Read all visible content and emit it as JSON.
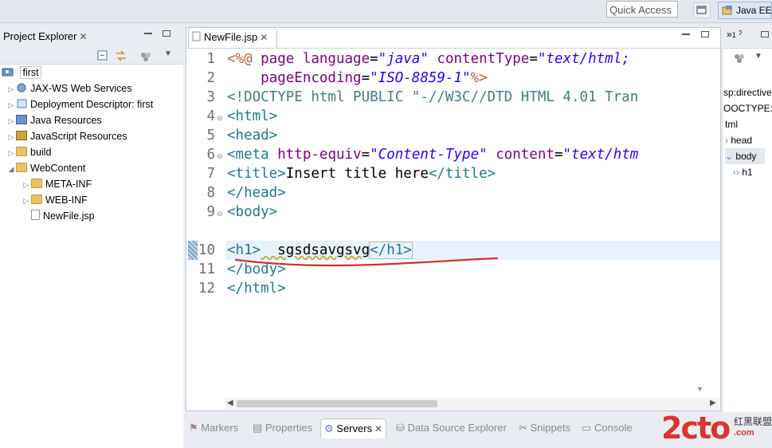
{
  "toolbar": {
    "quick_access": "Quick Access",
    "perspective": "Java EE"
  },
  "project_explorer": {
    "tab_label": "Project Explorer",
    "root": "first",
    "items": [
      {
        "label": "JAX-WS Web Services",
        "icon": "webservice-icon"
      },
      {
        "label": "Deployment Descriptor: first",
        "icon": "deployment-descriptor-icon"
      },
      {
        "label": "Java Resources",
        "icon": "java-resources-icon"
      },
      {
        "label": "JavaScript Resources",
        "icon": "javascript-resources-icon"
      },
      {
        "label": "build",
        "icon": "folder-icon"
      },
      {
        "label": "WebContent",
        "icon": "folder-icon"
      },
      {
        "label": "META-INF",
        "icon": "folder-icon"
      },
      {
        "label": "WEB-INF",
        "icon": "folder-icon"
      },
      {
        "label": "NewFile.jsp",
        "icon": "jsp-file-icon"
      }
    ]
  },
  "editor": {
    "tab_label": "NewFile.jsp",
    "line_numbers": [
      "1",
      "2",
      "3",
      "4",
      "5",
      "6",
      "7",
      "8",
      "9",
      "10",
      "11",
      "12"
    ],
    "lines": {
      "l1a": "<%@",
      "l1b": " page ",
      "l1c": "language",
      "l1d": "=",
      "l1e": "\"java\"",
      "l1f": " contentType",
      "l1g": "=",
      "l1h": "\"text/html;",
      "l2a": "    pageEncoding",
      "l2b": "=",
      "l2c": "\"ISO-8859-1\"",
      "l2d": "%>",
      "l3": "<!DOCTYPE html PUBLIC \"-//W3C//DTD HTML 4.01 Tran",
      "l4": "<html>",
      "l5": "<head>",
      "l6a": "<meta",
      "l6b": " http-equiv",
      "l6c": "=",
      "l6d": "\"Content-Type\"",
      "l6e": " content",
      "l6f": "=",
      "l6g": "\"text/htm",
      "l7a": "<title>",
      "l7b": "Insert title here",
      "l7c": "</title>",
      "l8": "</head>",
      "l9": "<body>",
      "l10a": "<h1>",
      "l10b": "  sgsdsavgsvg",
      "l10c": "</h1>",
      "l11": "</body>",
      "l12": "</html>"
    }
  },
  "bottom_tabs": [
    "Markers",
    "Properties",
    "Servers",
    "Data Source Explorer",
    "Snippets",
    "Console"
  ],
  "outline": {
    "tab_label": "1",
    "items": [
      "sp:directive",
      "OOCTYPE:h",
      "tml",
      "head",
      "body",
      "h1"
    ]
  },
  "watermark": {
    "logo": "2cto",
    "text1": "红黑联盟",
    "text2": ".com"
  },
  "colors": {
    "tag": "#1f7a8c",
    "attribute": "#7f007f",
    "string": "#2a00ff",
    "directive": "#bf5f3f",
    "current_line": "#e8f2fe",
    "annotation": "#d32f2f"
  }
}
